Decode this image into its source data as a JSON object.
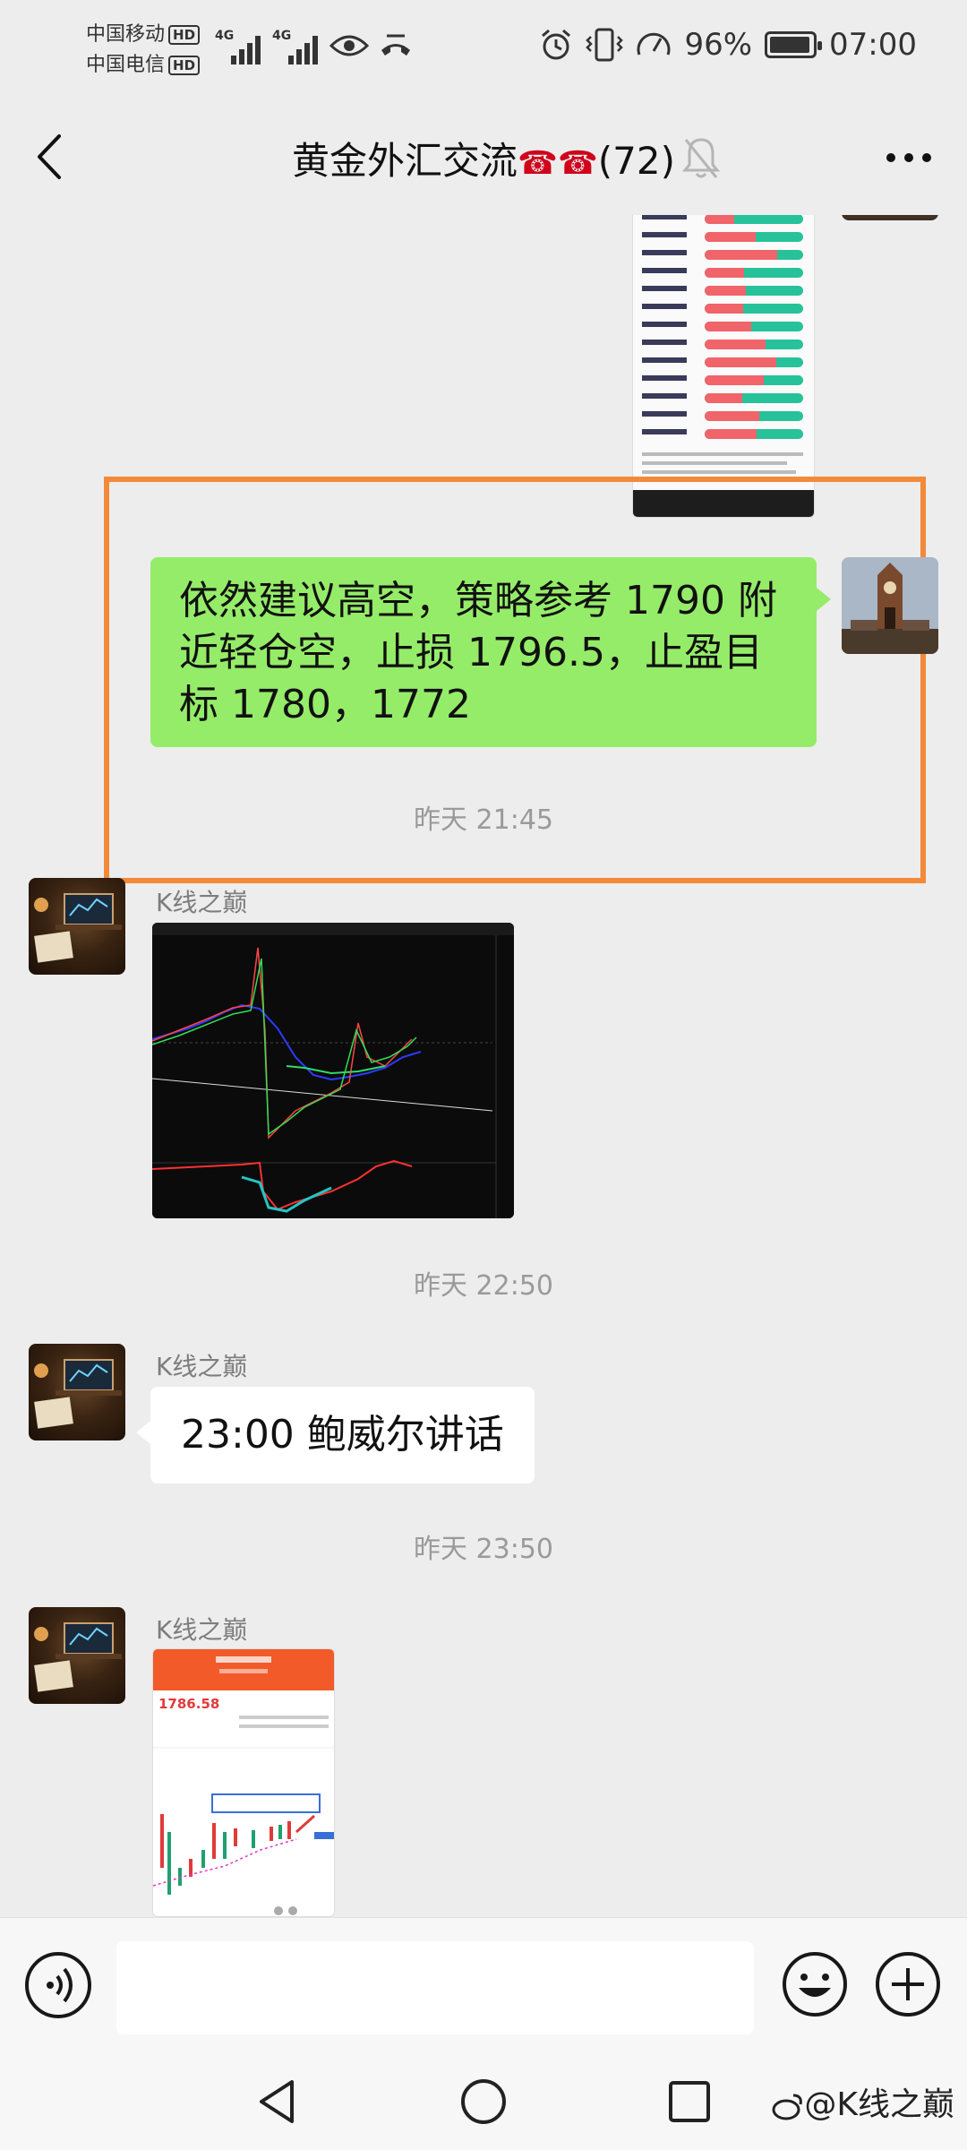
{
  "status_bar": {
    "carrier_1": "中国移动",
    "carrier_2": "中国电信",
    "hd_1": "HD",
    "hd_2": "HD",
    "signal_1_label": "4G",
    "signal_2_label": "4G",
    "battery_percent": "96%",
    "battery_level": 0.96,
    "time": "07:00"
  },
  "header": {
    "title": "黄金外汇交流",
    "title_icons": "☎☎",
    "member_count": "(72)"
  },
  "messages": {
    "my_message": "依然建议高空，策略参考 1790 附近轻仓空，止损 1796.5，止盈目标 1780，1772",
    "time_1": "昨天 21:45",
    "sender_1": "K线之巅",
    "time_2": "昨天 22:50",
    "sender_2": "K线之巅",
    "text_message": "23:00 鲍威尔讲话",
    "time_3": "昨天 23:50",
    "sender_3": "K线之巅",
    "app_price": "1786.58"
  },
  "input": {
    "value": "",
    "placeholder": ""
  },
  "watermark": "@K线之巅",
  "colors": {
    "bubble_self": "#95ec69",
    "bubble_other": "#ffffff",
    "highlight_border": "#f28a3a",
    "background": "#ededed"
  },
  "icons": {
    "back": "back-chevron-icon",
    "mute": "bell-muted-icon",
    "more": "more-dots-icon",
    "voice": "voice-icon",
    "emoji": "emoji-icon",
    "plus": "plus-icon",
    "nav_back": "triangle-back-icon",
    "nav_home": "circle-home-icon",
    "nav_recent": "square-recent-icon"
  }
}
